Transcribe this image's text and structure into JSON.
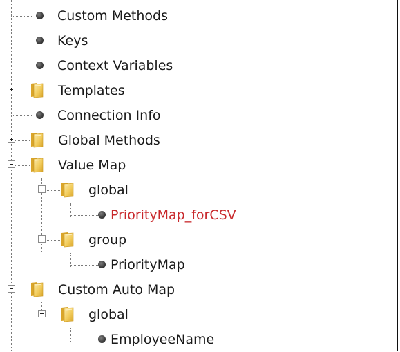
{
  "tree": {
    "items": [
      {
        "label": "Custom Methods",
        "level": 1,
        "type": "leaf"
      },
      {
        "label": "Keys",
        "level": 1,
        "type": "leaf"
      },
      {
        "label": "Context Variables",
        "level": 1,
        "type": "leaf"
      },
      {
        "label": "Templates",
        "level": 1,
        "type": "folder",
        "state": "collapsed"
      },
      {
        "label": "Connection Info",
        "level": 1,
        "type": "leaf"
      },
      {
        "label": "Global Methods",
        "level": 1,
        "type": "folder",
        "state": "collapsed"
      },
      {
        "label": "Value Map",
        "level": 1,
        "type": "folder",
        "state": "expanded"
      },
      {
        "label": "global",
        "level": 2,
        "type": "folder",
        "state": "expanded"
      },
      {
        "label": "PriorityMap_forCSV",
        "level": 3,
        "type": "leaf",
        "highlight": "red"
      },
      {
        "label": "group",
        "level": 2,
        "type": "folder",
        "state": "expanded"
      },
      {
        "label": "PriorityMap",
        "level": 3,
        "type": "leaf"
      },
      {
        "label": "Custom Auto Map",
        "level": 1,
        "type": "folder",
        "state": "expanded"
      },
      {
        "label": "global",
        "level": 2,
        "type": "folder",
        "state": "expanded"
      },
      {
        "label": "EmployeeName",
        "level": 3,
        "type": "leaf"
      }
    ]
  },
  "colors": {
    "highlight_text": "#c8282b",
    "folder_body": "#f2cc5c",
    "folder_dark": "#d9a52a"
  },
  "icons": {
    "leaf": "bullet-dot-icon",
    "folder": "folder-icon",
    "collapsed": "expand-plus-icon",
    "expanded": "collapse-minus-icon"
  }
}
